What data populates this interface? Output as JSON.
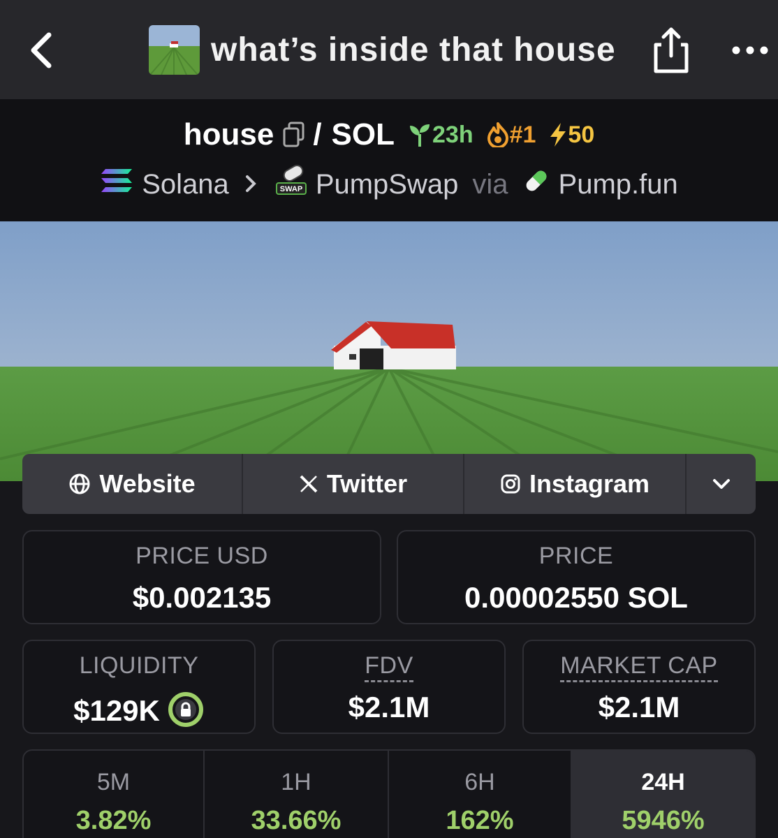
{
  "nav": {
    "title": "what’s inside that house"
  },
  "pair": {
    "base": "house",
    "quote": "SOL",
    "age": "23h",
    "rank": "#1",
    "boost": "50",
    "chain": "Solana",
    "dex": "PumpSwap",
    "via": "via",
    "launchpad": "Pump.fun",
    "swap_badge": "SWAP"
  },
  "links": {
    "website": "Website",
    "twitter": "Twitter",
    "instagram": "Instagram"
  },
  "stats": {
    "price_usd_label": "PRICE USD",
    "price_usd": "$0.002135",
    "price_label": "PRICE",
    "price": "0.00002550 SOL",
    "liquidity_label": "LIQUIDITY",
    "liquidity": "$129K",
    "fdv_label": "FDV",
    "fdv": "$2.1M",
    "mcap_label": "MARKET CAP",
    "mcap": "$2.1M"
  },
  "changes": [
    {
      "label": "5M",
      "value": "3.82%"
    },
    {
      "label": "1H",
      "value": "33.66%"
    },
    {
      "label": "6H",
      "value": "162%"
    },
    {
      "label": "24H",
      "value": "5946%"
    }
  ],
  "colors": {
    "positive": "#9fd06a",
    "age": "#7ed27a",
    "rank": "#f0a030",
    "boost": "#f5c542"
  }
}
